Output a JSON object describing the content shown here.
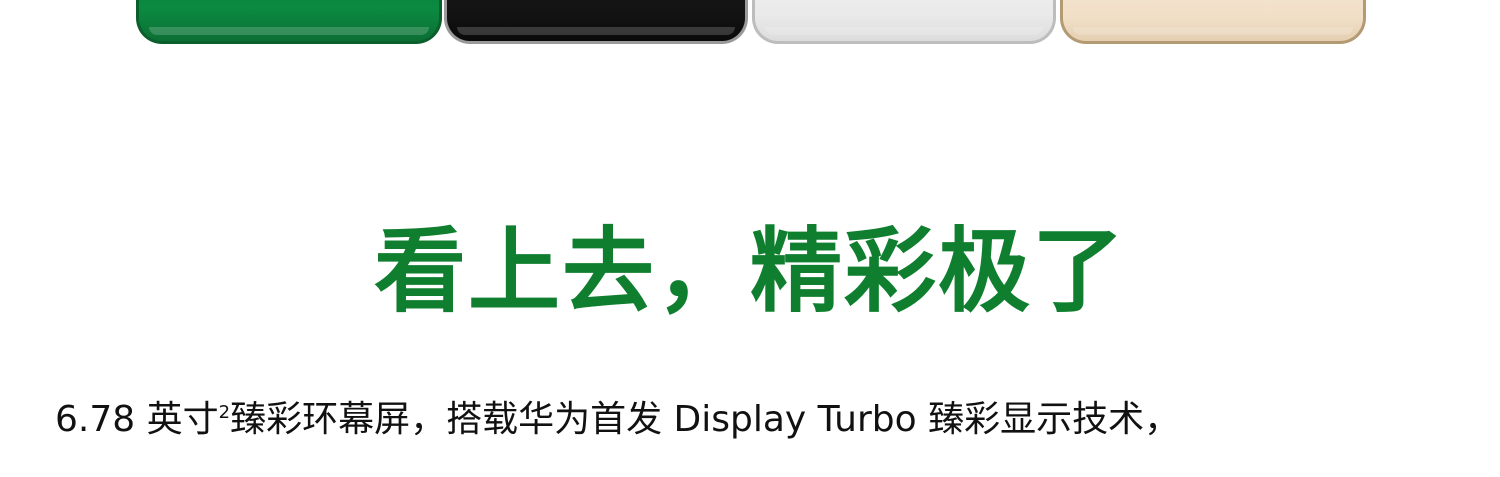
{
  "colors": {
    "headline": "#0f7f2f",
    "body_text": "#111111",
    "background": "#ffffff",
    "phone_green": "#0b8a41",
    "phone_black": "#121212",
    "phone_white": "#ececec",
    "phone_gold": "#f1dfc8"
  },
  "products": [
    {
      "name": "green-phone"
    },
    {
      "name": "black-phone"
    },
    {
      "name": "white-phone"
    },
    {
      "name": "gold-phone"
    }
  ],
  "headline": "看上去，精彩极了",
  "subline": {
    "size": "6.78 英寸",
    "footnote": "2",
    "rest": "臻彩环幕屏，搭载华为首发 Display Turbo 臻彩显示技术，"
  }
}
